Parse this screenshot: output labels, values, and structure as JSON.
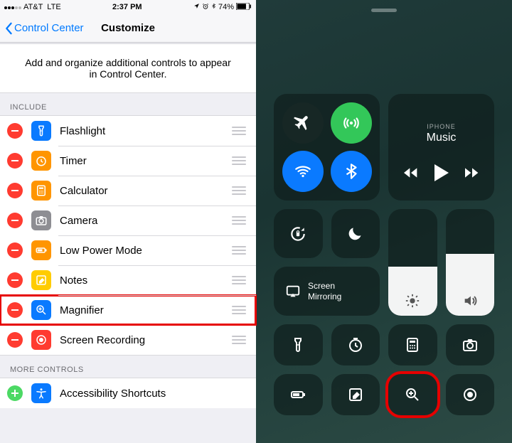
{
  "status": {
    "carrier": "AT&T",
    "network": "LTE",
    "time": "2:37 PM",
    "battery": "74%"
  },
  "nav": {
    "back": "Control Center",
    "title": "Customize"
  },
  "description": "Add and organize additional controls to appear in Control Center.",
  "sections": {
    "include_header": "INCLUDE",
    "more_header": "MORE CONTROLS"
  },
  "include": [
    {
      "label": "Flashlight",
      "icon": "flashlight-icon",
      "bg": "#0a7aff"
    },
    {
      "label": "Timer",
      "icon": "timer-icon",
      "bg": "#ff9500"
    },
    {
      "label": "Calculator",
      "icon": "calculator-icon",
      "bg": "#ff9500"
    },
    {
      "label": "Camera",
      "icon": "camera-icon",
      "bg": "#8e8e93"
    },
    {
      "label": "Low Power Mode",
      "icon": "battery-icon",
      "bg": "#ff9500"
    },
    {
      "label": "Notes",
      "icon": "notes-icon",
      "bg": "#ffcc00"
    },
    {
      "label": "Magnifier",
      "icon": "magnifier-icon",
      "bg": "#0a7aff",
      "highlight": true
    },
    {
      "label": "Screen Recording",
      "icon": "record-icon",
      "bg": "#ff3b30"
    }
  ],
  "more": [
    {
      "label": "Accessibility Shortcuts",
      "icon": "accessibility-icon",
      "bg": "#0a7aff"
    }
  ],
  "cc": {
    "nowplaying_source": "IPHONE",
    "nowplaying_title": "Music",
    "screen_mirroring": "Screen\nMirroring"
  }
}
